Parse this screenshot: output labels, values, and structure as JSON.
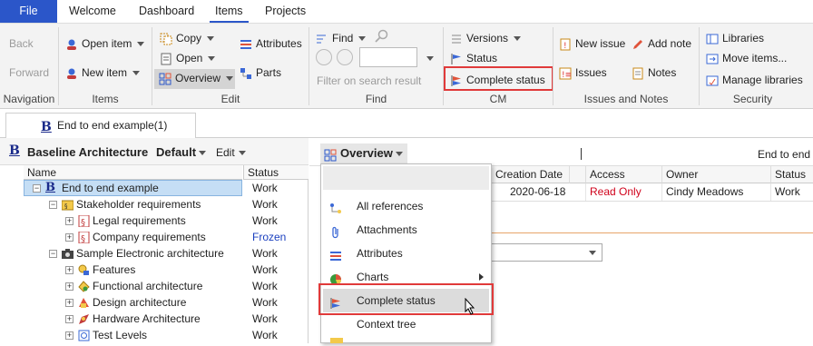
{
  "menu": {
    "file": "File",
    "tabs": [
      "Welcome",
      "Dashboard",
      "Items",
      "Projects"
    ]
  },
  "ribbon": {
    "navigation": {
      "back": "Back",
      "forward": "Forward",
      "label": "Navigation"
    },
    "items": {
      "open_item": "Open item",
      "new_item": "New item",
      "label": "Items"
    },
    "edit": {
      "copy": "Copy",
      "open": "Open",
      "overview": "Overview",
      "attributes": "Attributes",
      "parts": "Parts",
      "label": "Edit"
    },
    "find": {
      "find": "Find",
      "filter_placeholder": "Filter on search result",
      "label": "Find"
    },
    "cm": {
      "versions": "Versions",
      "status": "Status",
      "complete_status": "Complete status",
      "label": "CM"
    },
    "issues": {
      "new_issue": "New issue",
      "add_note": "Add note",
      "issues": "Issues",
      "notes": "Notes",
      "label": "Issues and Notes"
    },
    "security": {
      "libraries": "Libraries",
      "move_items": "Move items...",
      "manage_libraries": "Manage libraries",
      "label": "Security"
    }
  },
  "doc_tab": {
    "title": "End to end example(1)"
  },
  "left_panel": {
    "title": "Baseline Architecture",
    "variant": "Default",
    "edit": "Edit",
    "columns": {
      "name": "Name",
      "status": "Status"
    },
    "rows": [
      {
        "name": "End to end example",
        "status": "Work"
      },
      {
        "name": "Stakeholder requirements",
        "status": "Work"
      },
      {
        "name": "Legal requirements",
        "status": "Work"
      },
      {
        "name": "Company requirements",
        "status": "Frozen"
      },
      {
        "name": "Sample Electronic architecture",
        "status": "Work"
      },
      {
        "name": "Features",
        "status": "Work"
      },
      {
        "name": "Functional architecture",
        "status": "Work"
      },
      {
        "name": "Design architecture",
        "status": "Work"
      },
      {
        "name": "Hardware Architecture",
        "status": "Work"
      },
      {
        "name": "Test Levels",
        "status": "Work"
      }
    ]
  },
  "right_panel": {
    "overview": "Overview",
    "title": "End to end",
    "columns": {
      "creation_date": "Creation Date",
      "access": "Access",
      "owner": "Owner",
      "status": "Status"
    },
    "row": {
      "creation_date": "2020-06-18",
      "access": "Read Only",
      "owner": "Cindy Meadows",
      "status": "Work"
    }
  },
  "dropdown": {
    "items": [
      "All references",
      "Attachments",
      "Attributes",
      "Charts",
      "Complete status",
      "Context tree"
    ]
  },
  "colors": {
    "accent": "#2b56c9",
    "highlight_box": "#e03a3a",
    "read_only": "#d0021b",
    "frozen": "#1a3fbf"
  }
}
